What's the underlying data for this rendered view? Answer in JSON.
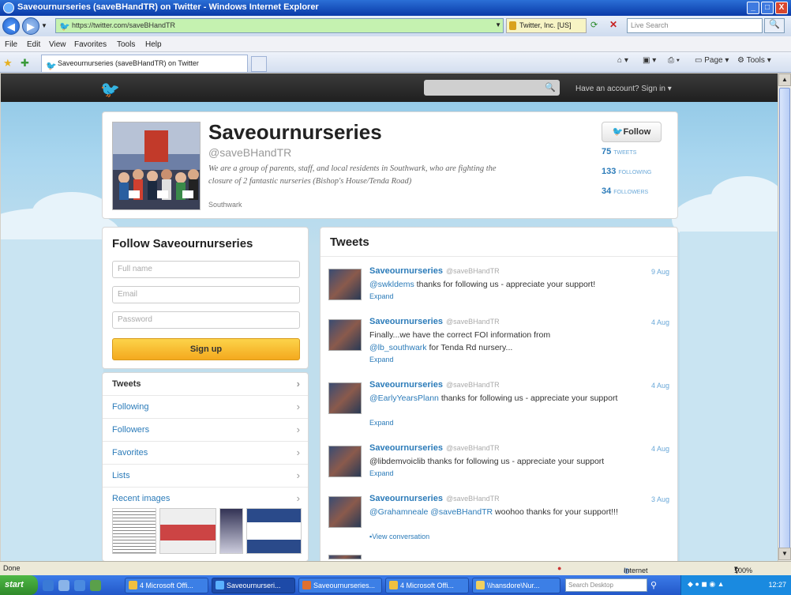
{
  "window": {
    "title": "Saveournurseries (saveBHandTR) on Twitter - Windows Internet Explorer",
    "minimize": "_",
    "maximize": "□",
    "close": "X"
  },
  "browser": {
    "back_icon": "back-arrow-icon",
    "url": "https://twitter.com/saveBHandTR",
    "cert_label": "Twitter, Inc. [US]",
    "search_placeholder": "Live Search",
    "menu": [
      "File",
      "Edit",
      "View",
      "Favorites",
      "Tools",
      "Help"
    ],
    "tab_title": "Saveournurseries (saveBHandTR) on Twitter",
    "toolbar_page": "Page",
    "toolbar_tools": "Tools"
  },
  "twitter": {
    "signin": "Have an account? Sign in",
    "profile": {
      "name": "Saveournurseries",
      "handle": "@saveBHandTR",
      "bio": "We are a group of parents, staff, and local residents in Southwark, who are fighting the closure of 2 fantastic nurseries (Bishop's House/Tenda Road)",
      "location": "Southwark",
      "follow_label": "Follow",
      "stats": [
        {
          "count": "75",
          "label": "TWEETS"
        },
        {
          "count": "133",
          "label": "FOLLOWING"
        },
        {
          "count": "34",
          "label": "FOLLOWERS"
        }
      ]
    },
    "signup_box": {
      "title": "Follow Saveournurseries",
      "fullname_placeholder": "Full name",
      "email_placeholder": "Email",
      "password_placeholder": "Password",
      "signup_label": "Sign up"
    },
    "nav": [
      "Tweets",
      "Following",
      "Followers",
      "Favorites",
      "Lists",
      "Recent images"
    ],
    "tweets_title": "Tweets",
    "tweets": [
      {
        "name": "Saveournurseries",
        "screen": "@saveBHandTR",
        "date": "9 Aug",
        "mention": "@swkldems",
        "text": " thanks for following us - appreciate your support!",
        "action": "Expand"
      },
      {
        "name": "Saveournurseries",
        "screen": "@saveBHandTR",
        "date": "4 Aug",
        "pre": "Finally...we have the correct FOI information from ",
        "mention": "@lb_southwark",
        "text": " for Tenda Rd nursery...",
        "action": "Expand"
      },
      {
        "name": "Saveournurseries",
        "screen": "@saveBHandTR",
        "date": "4 Aug",
        "mention": "@EarlyYearsPlann",
        "text": " thanks for following us - appreciate your support",
        "action": "Expand"
      },
      {
        "name": "Saveournurseries",
        "screen": "@saveBHandTR",
        "date": "4 Aug",
        "pre": "@libdemvoiclib thanks for following us - appreciate your support",
        "mention": "",
        "text": "",
        "action": "Expand"
      },
      {
        "name": "Saveournurseries",
        "screen": "@saveBHandTR",
        "date": "3 Aug",
        "mention": "@Grahamneale @saveBHandTR",
        "text": " woohoo thanks for your support!!!",
        "action": "View conversation"
      }
    ]
  },
  "statusbar": {
    "left": "Done",
    "zone": "Internet",
    "zoom": "100%"
  },
  "taskbar": {
    "start": "start",
    "buttons": [
      "4 Microsoft Offi...",
      "Saveournurseri...",
      "Saveournurseries...",
      "4 Microsoft Offi...",
      "\\\\hansdore\\Nur..."
    ],
    "search_placeholder": "Search Desktop",
    "clock": "12:27"
  },
  "colors": {
    "twitter_blue": "#2b7bb9",
    "sky": "#c0deed",
    "signup_yellow": "#f4a91e"
  }
}
